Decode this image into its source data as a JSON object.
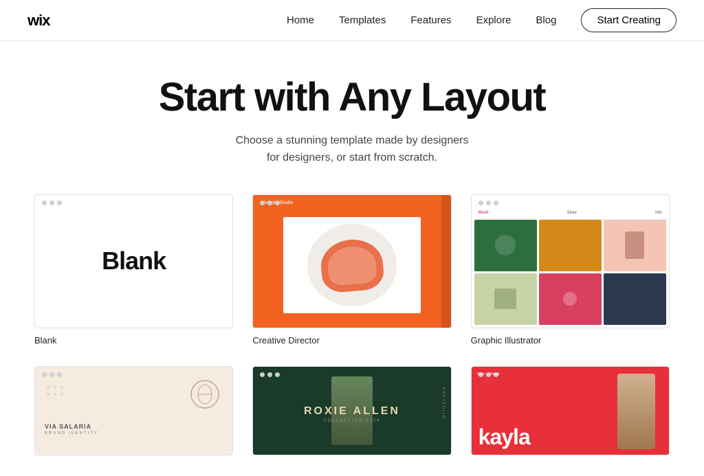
{
  "logo": "wix",
  "nav": {
    "links": [
      {
        "label": "Home",
        "id": "home"
      },
      {
        "label": "Templates",
        "id": "templates"
      },
      {
        "label": "Features",
        "id": "features"
      },
      {
        "label": "Explore",
        "id": "explore"
      },
      {
        "label": "Blog",
        "id": "blog"
      }
    ],
    "cta": "Start Creating"
  },
  "hero": {
    "title": "Start with Any Layout",
    "subtitle": "Choose a stunning template made by designers for designers, or start from scratch."
  },
  "templates": [
    {
      "id": "blank",
      "label": "Blank",
      "type": "blank"
    },
    {
      "id": "creative-director",
      "label": "Creative Director",
      "type": "creative"
    },
    {
      "id": "graphic-illustrator",
      "label": "Graphic Illustrator",
      "type": "graphic"
    }
  ],
  "bottom_templates": [
    {
      "id": "via-salaria",
      "label": "",
      "type": "beige"
    },
    {
      "id": "roxie-allen",
      "label": "",
      "type": "roxie"
    },
    {
      "id": "kayla",
      "label": "",
      "type": "kayla"
    }
  ]
}
